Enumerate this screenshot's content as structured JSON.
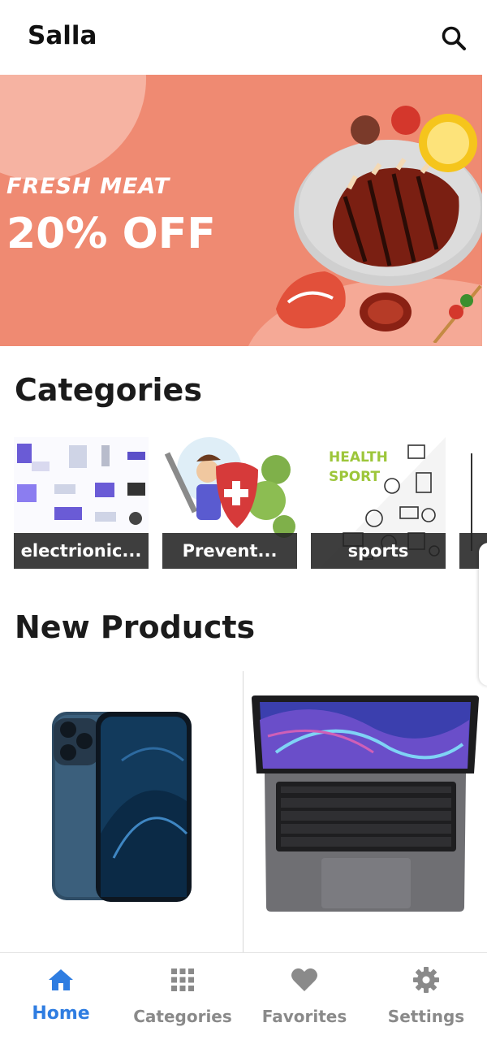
{
  "app": {
    "title": "Salla"
  },
  "banner": {
    "kicker": "FRESH MEAT",
    "headline": "20% OFF"
  },
  "sections": {
    "categories_title": "Categories",
    "new_products_title": "New Products"
  },
  "categories": [
    {
      "label": "electrionic...",
      "icon": "electronics-illustration"
    },
    {
      "label": "Prevent...",
      "icon": "prevention-illustration"
    },
    {
      "label": "sports",
      "icon": "sports-illustration",
      "art_text_1": "HEALTH",
      "art_text_2": "SPORT"
    }
  ],
  "products": [
    {
      "icon": "smartphone-image"
    },
    {
      "icon": "laptop-image"
    }
  ],
  "nav": [
    {
      "label": "Home",
      "icon": "home-icon",
      "active": true
    },
    {
      "label": "Categories",
      "icon": "grid-icon",
      "active": false
    },
    {
      "label": "Favorites",
      "icon": "heart-icon",
      "active": false
    },
    {
      "label": "Settings",
      "icon": "gear-icon",
      "active": false
    }
  ],
  "colors": {
    "accent": "#2f7de1",
    "banner": "#ef8a72",
    "nav_inactive": "#8a8a8a"
  }
}
